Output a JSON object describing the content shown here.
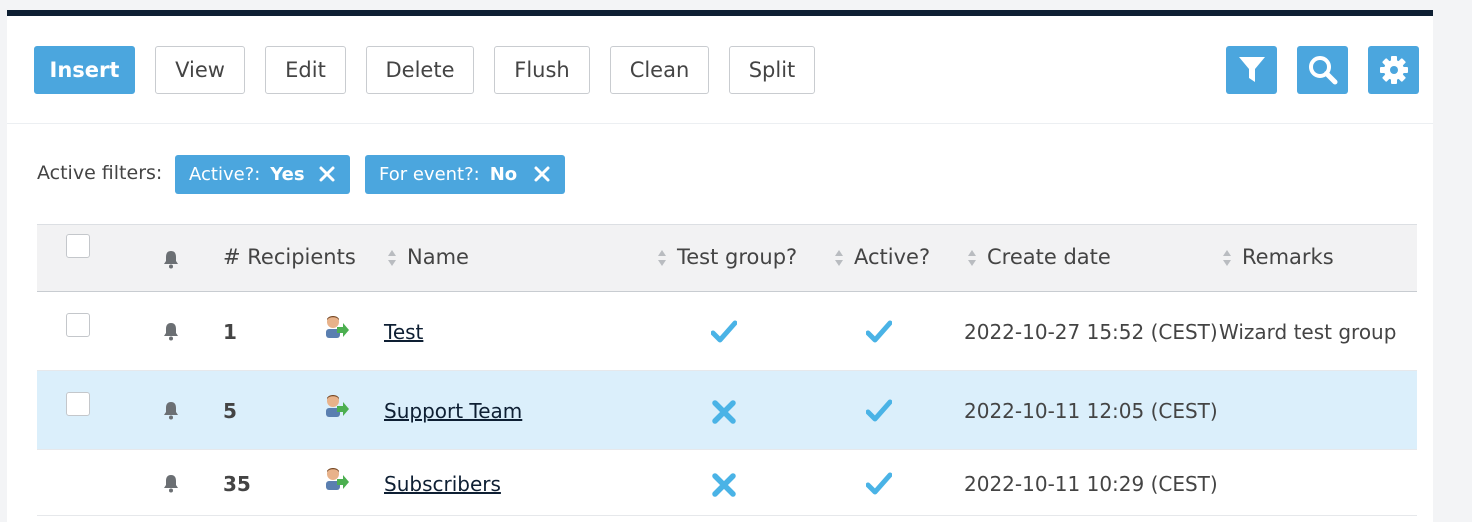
{
  "toolbar": {
    "buttons": [
      "Insert",
      "View",
      "Edit",
      "Delete",
      "Flush",
      "Clean",
      "Split"
    ],
    "icons": [
      "filter-icon",
      "search-icon",
      "gear-icon"
    ],
    "accent": "#4ba6de"
  },
  "filters": {
    "label": "Active filters:",
    "chips": [
      {
        "key": "Active?:",
        "value": "Yes"
      },
      {
        "key": "For event?:",
        "value": "No"
      }
    ]
  },
  "table": {
    "headers": {
      "recipients": "# Recipients",
      "name": "Name",
      "test_group": "Test group?",
      "active": "Active?",
      "create_date": "Create date",
      "remarks": "Remarks"
    },
    "rows": [
      {
        "recipients": "1",
        "name": "Test",
        "test_group": true,
        "active": true,
        "create_date": "2022-10-27 15:52 (CEST)",
        "remarks": "Wizard test group",
        "selected": false,
        "has_checkbox": true
      },
      {
        "recipients": "5",
        "name": "Support Team",
        "test_group": false,
        "active": true,
        "create_date": "2022-10-11 12:05 (CEST)",
        "remarks": "",
        "selected": true,
        "has_checkbox": true
      },
      {
        "recipients": "35",
        "name": "Subscribers",
        "test_group": false,
        "active": true,
        "create_date": "2022-10-11 10:29 (CEST)",
        "remarks": "",
        "selected": false,
        "has_checkbox": false
      }
    ]
  }
}
